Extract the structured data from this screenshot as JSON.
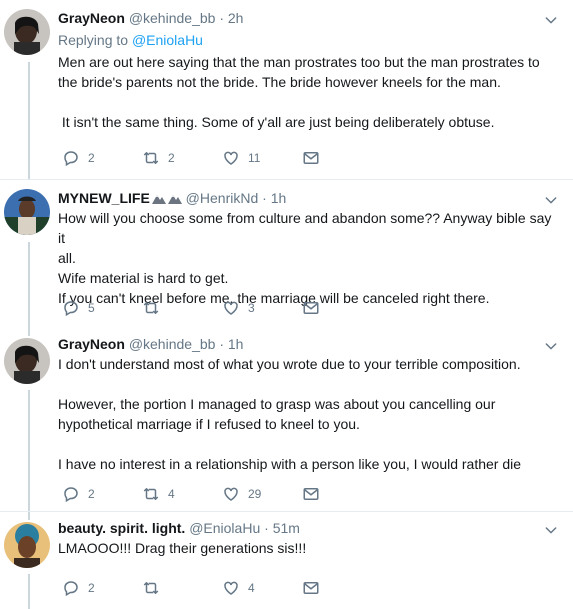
{
  "tweets": [
    {
      "name": "GrayNeon",
      "handle": "@kehinde_bb",
      "time": "2h",
      "replying_label": "Replying to",
      "replying_to": "@EniolaHu",
      "lines": [
        "Men are out here saying that the man prostrates too but the man prostrates to",
        "the bride's parents not the bride. The bride however kneels for the man.",
        "",
        " It isn't the same thing. Some of y'all are just being deliberately obtuse."
      ],
      "replies": "2",
      "retweets": "2",
      "likes": "11"
    },
    {
      "name": "MYNEW_LIFE",
      "handle": "@HenrikNd",
      "time": "1h",
      "lines": [
        "How will you choose some from culture and abandon some?? Anyway bible say it",
        "all.",
        "Wife material is hard to get.",
        "If you can't kneel before me, the marriage will be canceled right there."
      ],
      "replies": "5",
      "retweets": "",
      "likes": "3"
    },
    {
      "name": "GrayNeon",
      "handle": "@kehinde_bb",
      "time": "1h",
      "lines": [
        "I don't understand most of what you wrote due to your terrible composition.",
        "",
        "However, the portion I managed to grasp was about you cancelling our",
        "hypothetical marriage if I refused to kneel to you.",
        "",
        "I have no interest in a relationship with a person like you, I would rather die"
      ],
      "replies": "2",
      "retweets": "4",
      "likes": "29"
    },
    {
      "name": "beauty. spirit. light.",
      "handle": "@EniolaHu",
      "time": "51m",
      "lines": [
        "LMAOOO!!! Drag their generations sis!!!"
      ],
      "replies": "2",
      "retweets": "",
      "likes": "4"
    }
  ],
  "icons": {
    "reply": "reply-icon",
    "retweet": "retweet-icon",
    "like": "heart-icon",
    "dm": "envelope-icon",
    "caret": "chevron-down-icon"
  }
}
